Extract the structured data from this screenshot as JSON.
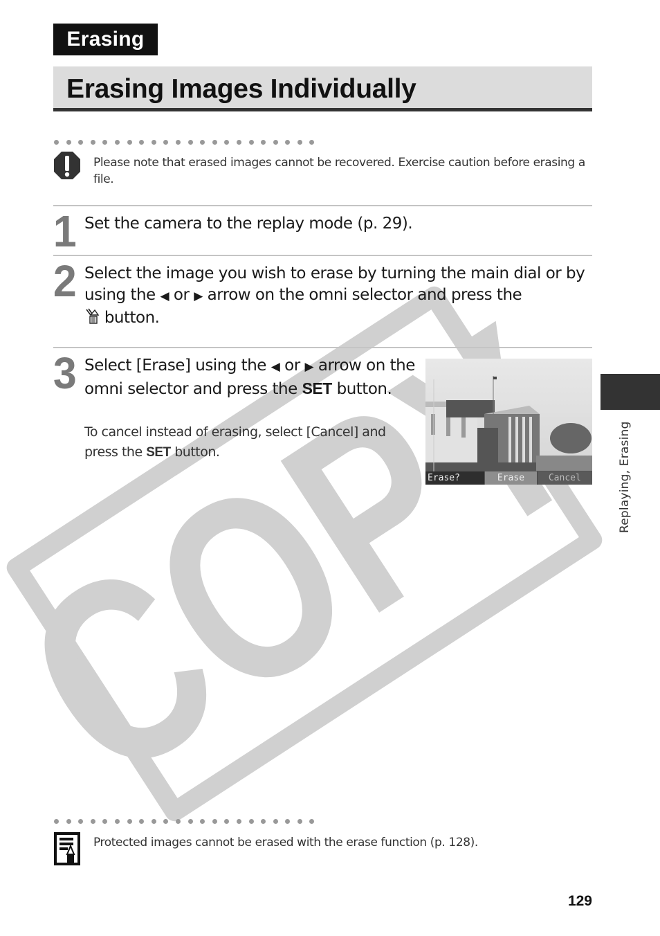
{
  "section_tag": "Erasing",
  "page_title": "Erasing Images Individually",
  "caution": {
    "icon": "caution-icon",
    "text": "Please note that erased images cannot be recovered. Exercise caution before erasing a file."
  },
  "steps": [
    {
      "number": "1",
      "text": "Set the camera to the replay mode (p. 29)."
    },
    {
      "number": "2",
      "text_part1": "Select the image you wish to erase by turning the main dial or by using the",
      "left_arrow": "◀",
      "or": "or",
      "right_arrow": "▶",
      "text_part2": "arrow on the omni selector and press the",
      "erase_button_icon": "trash-erase-icon",
      "text_part3": "button."
    },
    {
      "number": "3",
      "text_part1": "Select [Erase] using the",
      "left_arrow": "◀",
      "or": "or",
      "right_arrow": "▶",
      "text_part2": "arrow on the omni selector and press the",
      "set_label": "SET",
      "text_part3": "button.",
      "sub_part1": "To cancel instead of erasing, select [Cancel] and press the",
      "sub_set_label": "SET",
      "sub_part2": "button.",
      "screen": {
        "prompt": "Erase?",
        "option_erase": "Erase",
        "option_cancel": "Cancel"
      }
    }
  ],
  "note": {
    "icon": "memo-pencil-icon",
    "text": "Protected images cannot be erased with the erase function (p. 128)."
  },
  "side_tab": "Replaying, Erasing",
  "page_number": "129",
  "watermark": "COPY",
  "colors": {
    "section_tag_bg": "#111111",
    "title_bar_bg": "#dcdcdc",
    "step_number": "#7a7a7a",
    "watermark": "#d0d0d0"
  }
}
